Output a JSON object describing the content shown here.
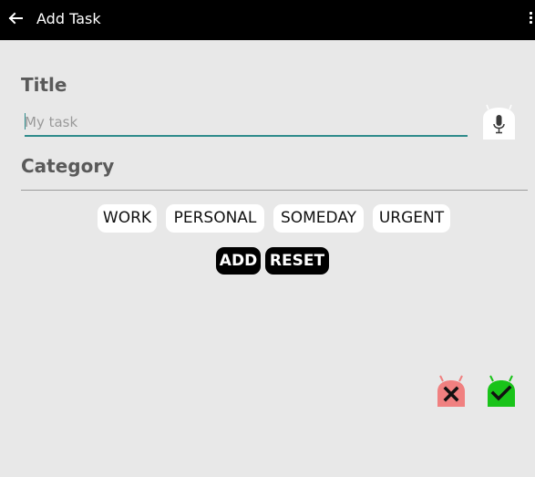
{
  "action_bar": {
    "back_icon": "arrow-left-icon",
    "title": "Add Task",
    "overflow_icon": "vertical-dots-icon"
  },
  "form": {
    "title_label": "Title",
    "task_input": {
      "value": "",
      "placeholder": "My task"
    },
    "mic_icon": "microphone-icon",
    "category_label": "Category",
    "categories": [
      "WORK",
      "PERSONAL",
      "SOMEDAY",
      "URGENT"
    ],
    "add_label": "ADD",
    "reset_label": "RESET"
  },
  "footer": {
    "cancel_icon": "cancel-x-icon",
    "confirm_icon": "confirm-check-icon"
  },
  "colors": {
    "background": "#e8e8e8",
    "action_bar": "#000000",
    "input_underline": "#2e8b8b",
    "cancel": "#f08080",
    "confirm": "#19c319"
  }
}
